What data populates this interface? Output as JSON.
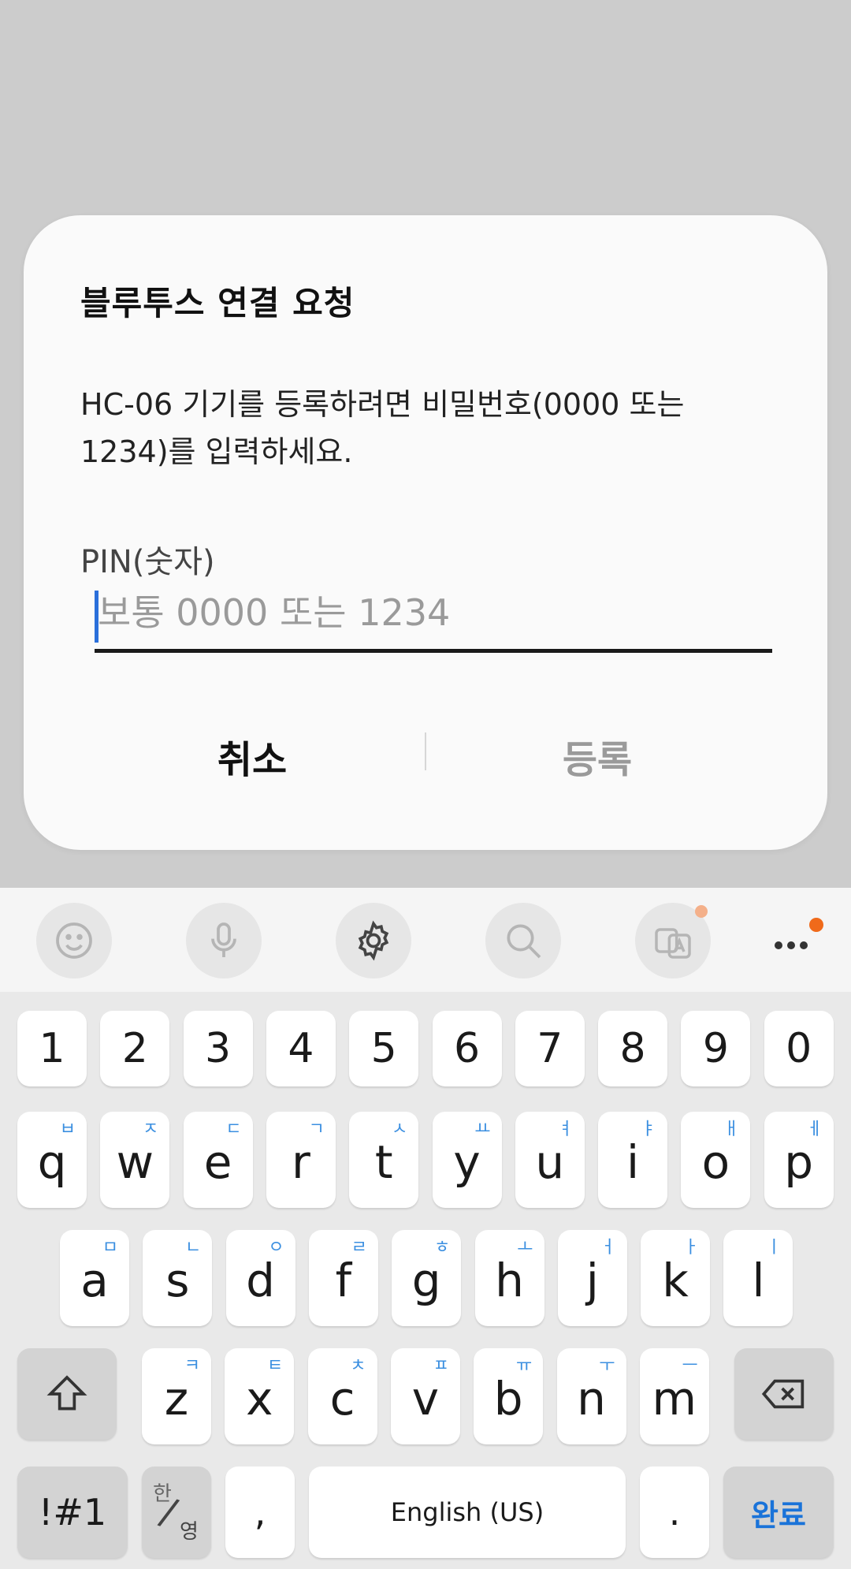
{
  "dialog": {
    "title": "블루투스 연결 요청",
    "message": "HC-06 기기를 등록하려면 비밀번호(0000 또는 1234)를 입력하세요.",
    "pin_label": "PIN(숫자)",
    "pin_value": "",
    "pin_placeholder": "보통 0000 또는 1234",
    "cancel_label": "취소",
    "register_label": "등록"
  },
  "keyboard": {
    "toolbar": [
      "emoji-icon",
      "microphone-icon",
      "settings-icon",
      "search-icon",
      "translate-icon",
      "more-icon"
    ],
    "number_row": [
      "1",
      "2",
      "3",
      "4",
      "5",
      "6",
      "7",
      "8",
      "9",
      "0"
    ],
    "row1": [
      {
        "key": "q",
        "hint": "ㅂ"
      },
      {
        "key": "w",
        "hint": "ㅈ"
      },
      {
        "key": "e",
        "hint": "ㄷ"
      },
      {
        "key": "r",
        "hint": "ㄱ"
      },
      {
        "key": "t",
        "hint": "ㅅ"
      },
      {
        "key": "y",
        "hint": "ㅛ"
      },
      {
        "key": "u",
        "hint": "ㅕ"
      },
      {
        "key": "i",
        "hint": "ㅑ"
      },
      {
        "key": "o",
        "hint": "ㅐ"
      },
      {
        "key": "p",
        "hint": "ㅔ"
      }
    ],
    "row2": [
      {
        "key": "a",
        "hint": "ㅁ"
      },
      {
        "key": "s",
        "hint": "ㄴ"
      },
      {
        "key": "d",
        "hint": "ㅇ"
      },
      {
        "key": "f",
        "hint": "ㄹ"
      },
      {
        "key": "g",
        "hint": "ㅎ"
      },
      {
        "key": "h",
        "hint": "ㅗ"
      },
      {
        "key": "j",
        "hint": "ㅓ"
      },
      {
        "key": "k",
        "hint": "ㅏ"
      },
      {
        "key": "l",
        "hint": "ㅣ"
      }
    ],
    "row3": [
      {
        "key": "z",
        "hint": "ㅋ"
      },
      {
        "key": "x",
        "hint": "ㅌ"
      },
      {
        "key": "c",
        "hint": "ㅊ"
      },
      {
        "key": "v",
        "hint": "ㅍ"
      },
      {
        "key": "b",
        "hint": "ㅠ"
      },
      {
        "key": "n",
        "hint": "ㅜ"
      },
      {
        "key": "m",
        "hint": "ㅡ"
      }
    ],
    "symbols_label": "!#1",
    "lang_top": "한",
    "lang_bottom": "영",
    "comma": ",",
    "space_label": "English (US)",
    "period": ".",
    "done_label": "완료",
    "colors": {
      "accent": "#1a73d9",
      "hint": "#3b8fe0",
      "notify": "#f06a1a"
    }
  }
}
